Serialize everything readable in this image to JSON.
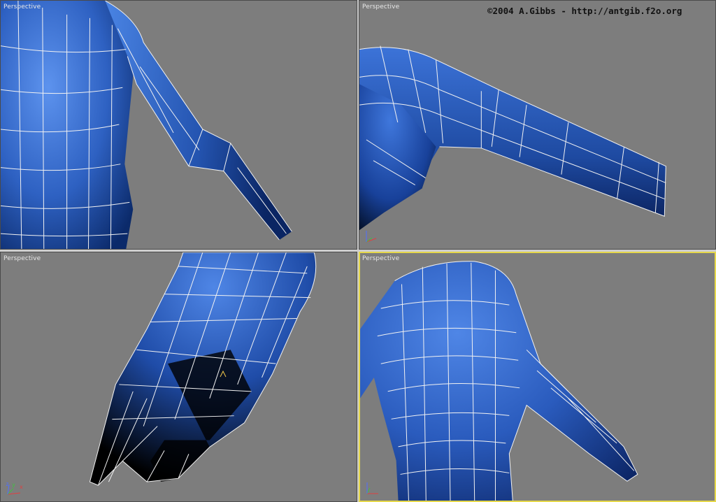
{
  "watermark": "©2004 A.Gibbs - http://antgib.f2o.org",
  "colors": {
    "viewport_bg": "#7d7d7d",
    "active_border": "#e6d84a",
    "mesh_blue": "#2f64c4",
    "wireframe": "#f2f2f2"
  },
  "viewports": [
    {
      "id": "top-left",
      "label": "Perspective",
      "active": false
    },
    {
      "id": "top-right",
      "label": "Perspective",
      "active": false
    },
    {
      "id": "bottom-left",
      "label": "Perspective",
      "active": false
    },
    {
      "id": "bottom-right",
      "label": "Perspective",
      "active": true
    }
  ],
  "axis_gizmo": {
    "x": "x",
    "y": "y",
    "z": "z"
  }
}
